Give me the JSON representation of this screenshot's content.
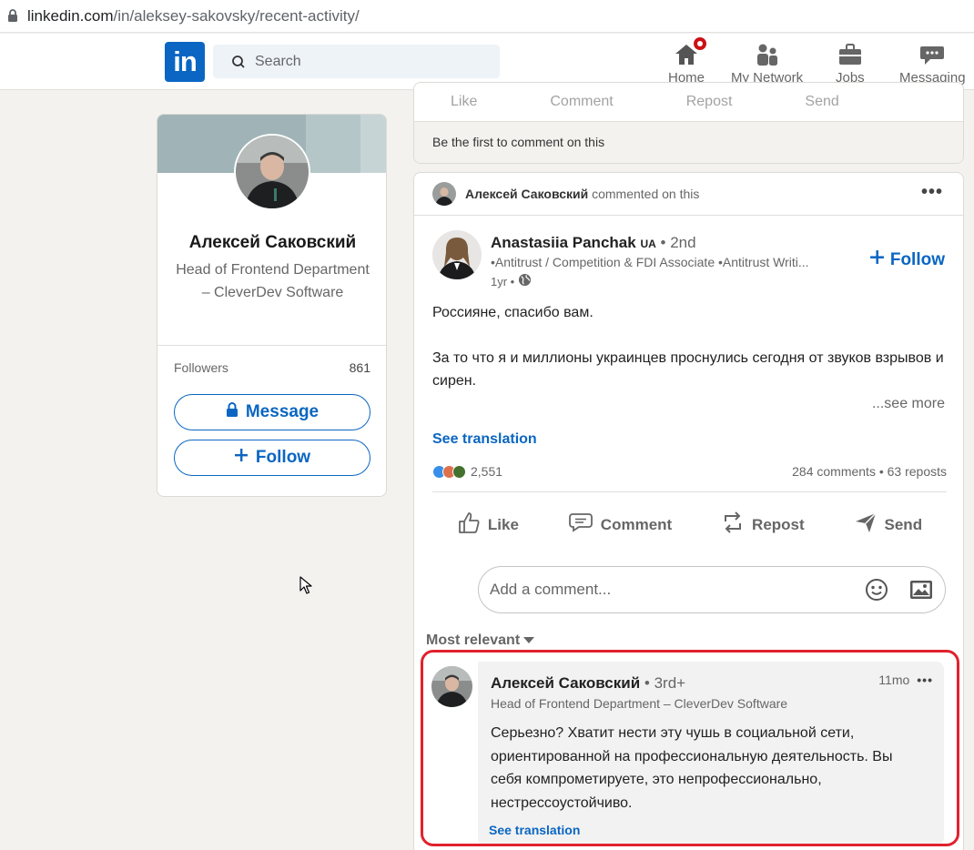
{
  "browser": {
    "url_host": "linkedin.com",
    "url_path": "/in/aleksey-sakovsky/recent-activity/"
  },
  "nav": {
    "logo": "in",
    "search_placeholder": "Search",
    "items": [
      {
        "label": "Home",
        "icon": "home-icon"
      },
      {
        "label": "My Network",
        "icon": "network-icon"
      },
      {
        "label": "Jobs",
        "icon": "briefcase-icon"
      },
      {
        "label": "Messaging",
        "icon": "messaging-icon"
      }
    ]
  },
  "profile": {
    "name": "Алексей Саковский",
    "headline": "Head of Frontend Department – CleverDev Software",
    "followers_label": "Followers",
    "followers_count": "861",
    "message_label": "Message",
    "follow_label": "Follow"
  },
  "prev_post": {
    "actions": [
      "Like",
      "Comment",
      "Repost",
      "Send"
    ],
    "first_comment": "Be the first to comment on this"
  },
  "post": {
    "context_name": "Алексей Саковский",
    "context_action": "commented on this",
    "author_name": "Anastasiia Panchak",
    "author_flag": "UA",
    "author_degree": "• 2nd",
    "author_subtitle": "•Antitrust / Competition & FDI Associate •Antitrust Writi...",
    "author_time": "1yr •",
    "follow_label": "Follow",
    "text_1": "Россияне, спасибо вам.",
    "text_2": "За то что я и миллионы украинцев проснулись сегодня от звуков взрывов и сирен.",
    "see_more": "...see more",
    "see_translation": "See translation",
    "reactions_count": "2,551",
    "comments_reposts": "284 comments • 63 reposts",
    "actions": {
      "like": "Like",
      "comment": "Comment",
      "repost": "Repost",
      "send": "Send"
    },
    "comment_placeholder": "Add a comment...",
    "sort_label": "Most relevant"
  },
  "comment": {
    "name": "Алексей Саковский",
    "degree": "• 3rd+",
    "headline": "Head of Frontend Department – CleverDev Software",
    "time": "11mo",
    "text": "Серьезно? Хватит нести эту чушь в социальной сети, ориентированной на профессиональную деятельность. Вы себя компрометируете, это непрофессионально, нестрессоустойчиво.",
    "see_translation": "See translation"
  },
  "colors": {
    "brand": "#0a66c2",
    "highlight": "#e0222d",
    "notification": "#cc1016"
  }
}
